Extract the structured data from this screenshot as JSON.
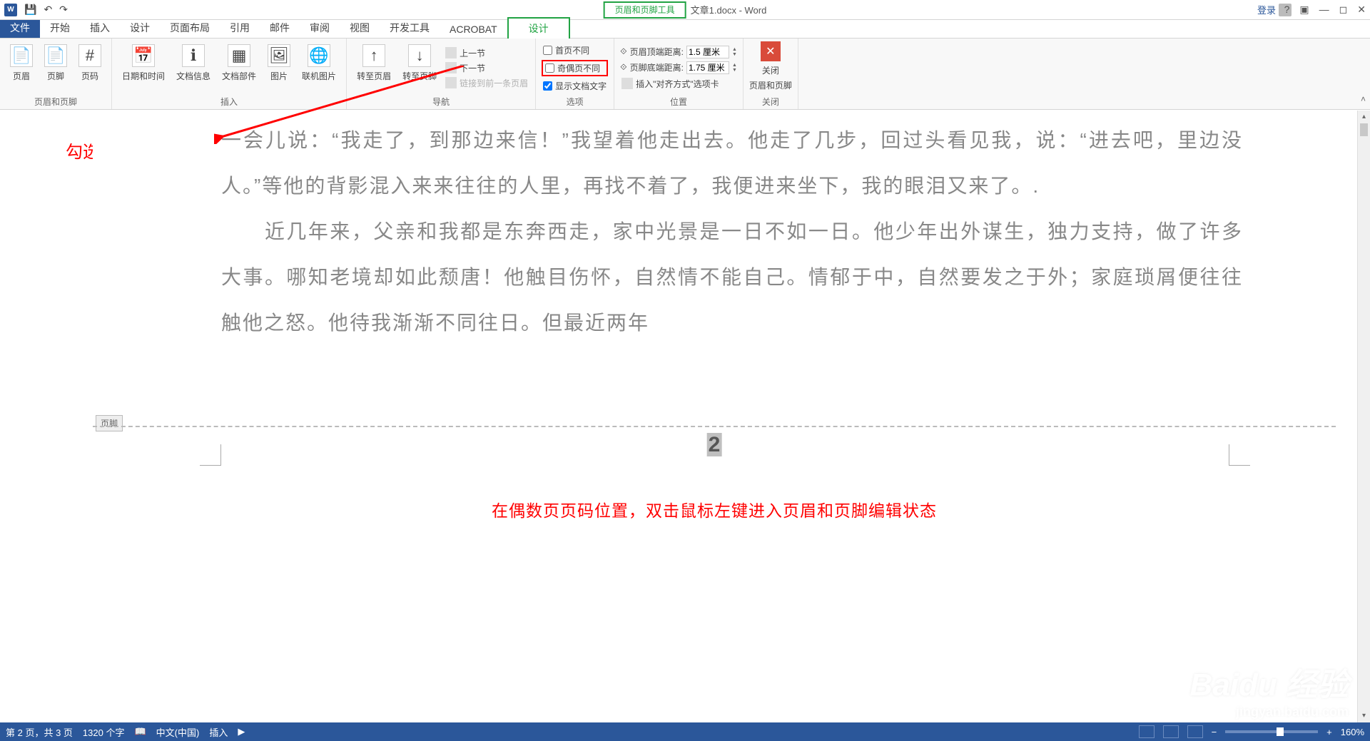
{
  "title": {
    "contextual": "页眉和页脚工具",
    "doc": "文章1.docx - Word",
    "login": "登录"
  },
  "qat": {
    "save": "💾",
    "undo": "↶",
    "redo": "↷"
  },
  "tabs": {
    "file": "文件",
    "home": "开始",
    "insert": "插入",
    "design": "设计",
    "layout": "页面布局",
    "ref": "引用",
    "mail": "邮件",
    "review": "审阅",
    "view": "视图",
    "dev": "开发工具",
    "acrobat": "ACROBAT",
    "hf_design": "设计"
  },
  "ribbon": {
    "g1": {
      "header": "页眉",
      "footer": "页脚",
      "pagenum": "页码",
      "label": "页眉和页脚"
    },
    "g2": {
      "datetime": "日期和时间",
      "docinfo": "文档信息",
      "quickparts": "文档部件",
      "picture": "图片",
      "online": "联机图片",
      "label": "插入"
    },
    "g3": {
      "gotoHeader": "转至页眉",
      "gotoFooter": "转至页脚",
      "prev": "上一节",
      "next": "下一节",
      "link": "链接到前一条页眉",
      "label": "导航"
    },
    "g4": {
      "diffFirst": "首页不同",
      "diffOddEven": "奇偶页不同",
      "showDoc": "显示文档文字",
      "label": "选项"
    },
    "g5": {
      "topLabel": "页眉顶端距离:",
      "topVal": "1.5 厘米",
      "botLabel": "页脚底端距离:",
      "botVal": "1.75 厘米",
      "insertAlign": "插入\"对齐方式\"选项卡",
      "label": "位置"
    },
    "g6": {
      "close": "关闭",
      "closeSub": "页眉和页脚",
      "label": "关闭"
    }
  },
  "annotations": {
    "gouxuan": "勾选",
    "footerNote": "在偶数页页码位置，双击鼠标左键进入页眉和页脚编辑状态",
    "footerTag": "页脚"
  },
  "document": {
    "p1": "一会儿说：“我走了，到那边来信！”我望着他走出去。他走了几步，回过头看见我，说：“进去吧，里边没人。”等他的背影混入来来往往的人里，再找不着了，我便进来坐下，我的眼泪又来了。.",
    "p2": "　　近几年来，父亲和我都是东奔西走，家中光景是一日不如一日。他少年出外谋生，独力支持，做了许多大事。哪知老境却如此颓唐！他触目伤怀，自然情不能自己。情郁于中，自然要发之于外；家庭琐屑便往往触他之怒。他待我渐渐不同往日。但最近两年",
    "pageNum": "2"
  },
  "status": {
    "page": "第 2 页，共 3 页",
    "words": "1320 个字",
    "lang": "中文(中国)",
    "mode": "插入",
    "zoom": "160%"
  }
}
